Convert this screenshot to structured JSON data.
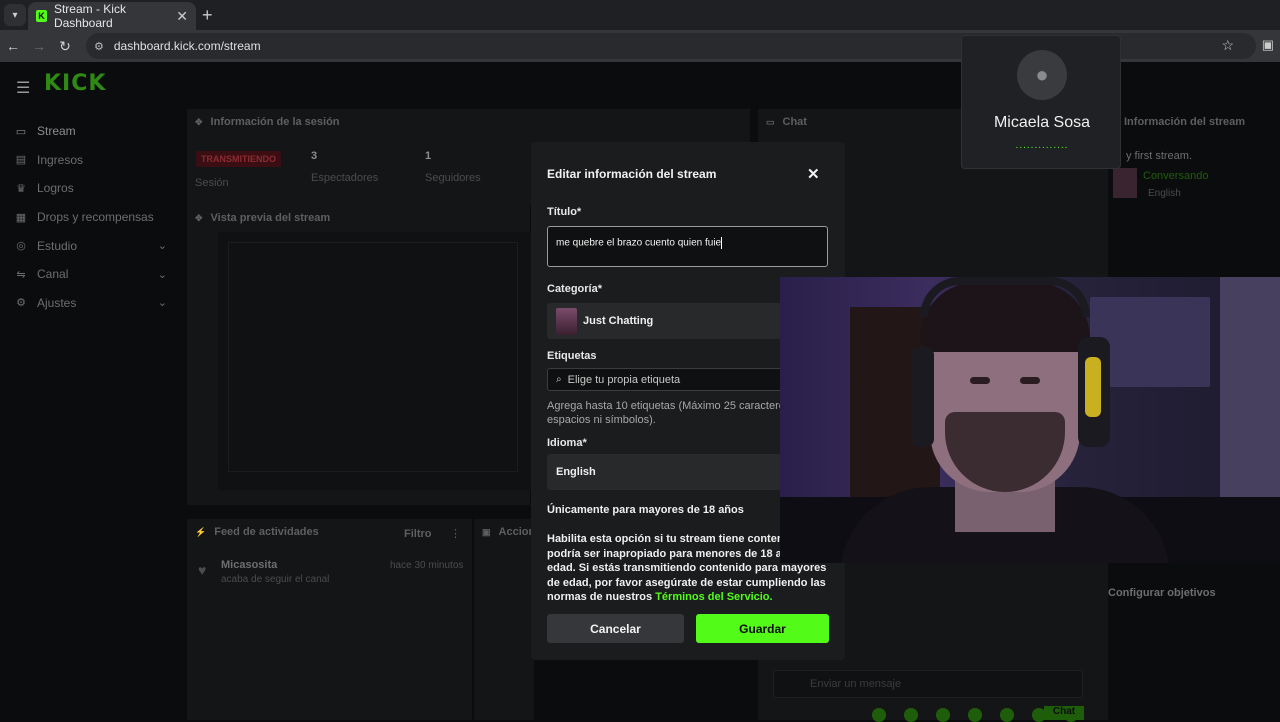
{
  "browser": {
    "tab_title": "Stream - Kick Dashboard",
    "favicon": "K",
    "url": "dashboard.kick.com/stream"
  },
  "app": {
    "logo": "KICK",
    "sidebar": [
      {
        "label": "Stream",
        "icon": "video-icon"
      },
      {
        "label": "Ingresos",
        "icon": "dollar-icon"
      },
      {
        "label": "Logros",
        "icon": "trophy-icon"
      },
      {
        "label": "Drops y recompensas",
        "icon": "gift-icon"
      },
      {
        "label": "Estudio",
        "icon": "studio-icon"
      },
      {
        "label": "Canal",
        "icon": "channel-icon"
      },
      {
        "label": "Ajustes",
        "icon": "gear-icon"
      }
    ],
    "session": {
      "header": "Información de la sesión",
      "badge": "TRANSMITIENDO",
      "session_label": "Sesión",
      "viewers_value": "3",
      "viewers_label": "Espectadores",
      "followers_value": "1",
      "followers_label": "Seguidores"
    },
    "preview_header": "Vista previa del stream",
    "chat_header": "Chat",
    "stream_info_header": "Información del stream",
    "stream_info_title": "y first stream.",
    "stream_info_category": "Conversando",
    "stream_info_language": "English",
    "feed": {
      "header": "Feed de actividades",
      "filter": "Filtro",
      "actions_header": "Accione",
      "item_user": "Micasosita",
      "item_text": "acaba de seguir el canal",
      "item_time": "hace 30 minutos"
    },
    "configure_goals": "Configurar objetivos",
    "chat_placeholder": "Enviar un mensaje",
    "chat_button": "Chat"
  },
  "modal": {
    "title": "Editar información del stream",
    "title_label": "Título*",
    "title_value": "me quebre el brazo cuento quien fuie",
    "category_label": "Categoría*",
    "category_value": "Just Chatting",
    "tags_label": "Etiquetas",
    "tags_placeholder": "Elige tu propia etiqueta",
    "tags_help": "Agrega hasta 10 etiquetas (Máximo 25 caracteres espacios ni símbolos).",
    "language_label": "Idioma*",
    "language_value": "English",
    "adult_title": "Únicamente para mayores de 18 años",
    "adult_text_1": "Habilita esta opción si tu stream tiene contenido que podría ser inapropiado para menores de 18 años de edad. Si estás transmitiendo contenido para mayores de edad, por favor asegúrate de estar cumpliendo las normas de nuestros ",
    "adult_tos": "Términos del Servicio.",
    "cancel": "Cancelar",
    "save": "Guardar"
  },
  "call": {
    "name": "Micaela Sosa",
    "status_dots": "..............",
    "icon": "person-icon"
  },
  "colors": {
    "accent": "#53fc18",
    "badge_live": "#8c2b33",
    "modal_bg": "#1a1c1e"
  }
}
